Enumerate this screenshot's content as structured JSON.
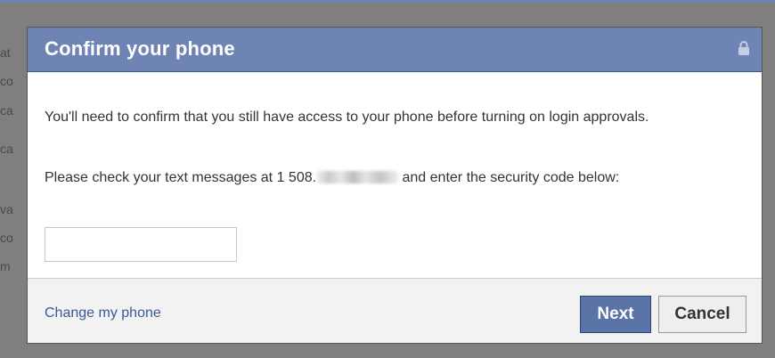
{
  "background_page": {
    "fragments": [
      "at",
      "co",
      "ca",
      "ca",
      "va",
      "co",
      "m"
    ]
  },
  "dialog": {
    "title": "Confirm your phone",
    "header_icon": "lock-icon",
    "message_1": "You'll need to confirm that you still have access to your phone before turning on login approvals.",
    "message_2_prefix": "Please check your text messages at 1 508.",
    "message_2_suffix": " and enter the security code below:",
    "code_input": {
      "value": "",
      "placeholder": ""
    },
    "footer": {
      "change_link": "Change my phone",
      "next_label": "Next",
      "cancel_label": "Cancel"
    }
  },
  "colors": {
    "header_blue": "#6d84b4",
    "button_blue": "#5b74a8",
    "link_blue": "#3b5998",
    "footer_gray": "#f2f2f2"
  }
}
